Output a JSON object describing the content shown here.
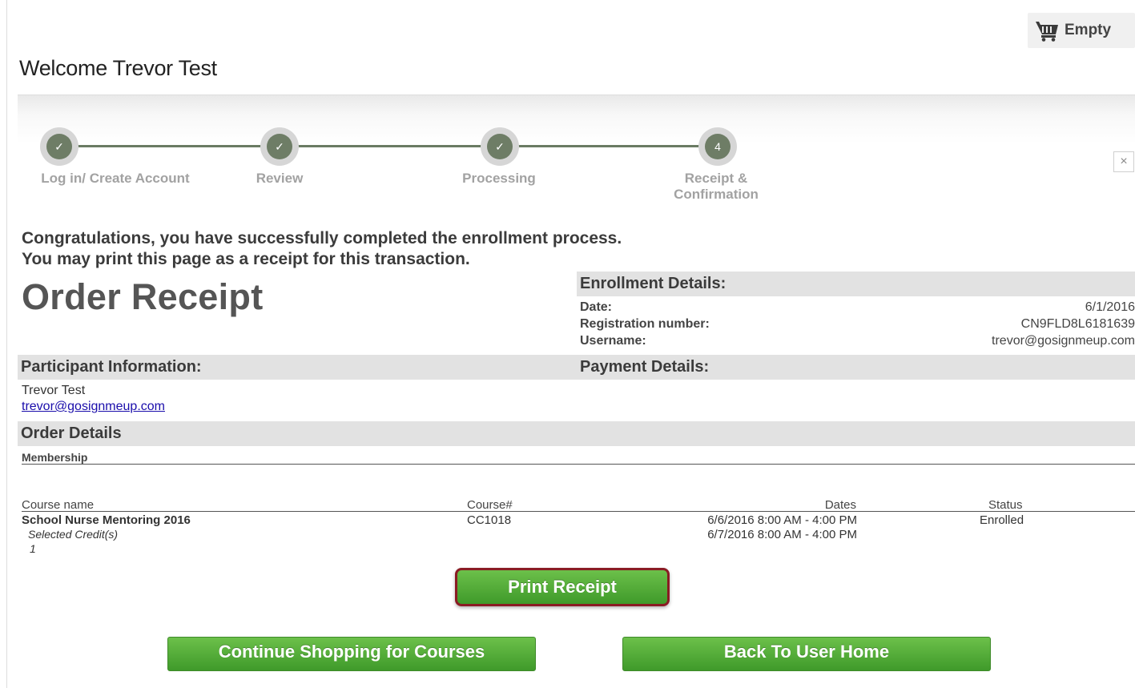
{
  "cart": {
    "label": "Empty",
    "icon": "shopping-basket-icon"
  },
  "welcome": "Welcome Trevor Test",
  "steps": [
    {
      "label": "Log in/ Create Account",
      "marker": "✓",
      "status": "complete"
    },
    {
      "label": "Review",
      "marker": "✓",
      "status": "complete"
    },
    {
      "label": "Processing",
      "marker": "✓",
      "status": "complete"
    },
    {
      "label": "Receipt &",
      "label2": "Confirmation",
      "marker": "4",
      "status": "current"
    }
  ],
  "close_icon": "×",
  "congrats": {
    "line1": "Congratulations, you have successfully completed the enrollment process.",
    "line2": "You may print this page as a receipt for this transaction."
  },
  "order_receipt_title": "Order Receipt",
  "enrollment": {
    "heading": "Enrollment Details:",
    "date_label": "Date:",
    "date_value": "6/1/2016",
    "reg_label": "Registration number:",
    "reg_value": "CN9FLD8L6181639",
    "user_label": "Username:",
    "user_value": "trevor@gosignmeup.com"
  },
  "participant": {
    "heading": "Participant Information:",
    "name": "Trevor Test",
    "email": "trevor@gosignmeup.com"
  },
  "payment": {
    "heading": "Payment Details:"
  },
  "order_details": {
    "heading": "Order Details",
    "membership": "Membership",
    "columns": {
      "course_name": "Course name",
      "course_num": "Course#",
      "dates": "Dates",
      "status": "Status"
    },
    "row": {
      "course_name": "School Nurse Mentoring 2016",
      "credits_label": "Selected Credit(s)",
      "credits_value": "1",
      "course_num": "CC1018",
      "date1": "6/6/2016 8:00 AM - 4:00 PM",
      "date2": "6/7/2016 8:00 AM - 4:00 PM",
      "status": "Enrolled"
    }
  },
  "buttons": {
    "print": "Print Receipt",
    "continue": "Continue Shopping for Courses",
    "home": "Back To User Home"
  },
  "colors": {
    "button_green": "#4fa835",
    "highlight_border": "#8a1c24",
    "step_dark": "#6e7d66"
  }
}
